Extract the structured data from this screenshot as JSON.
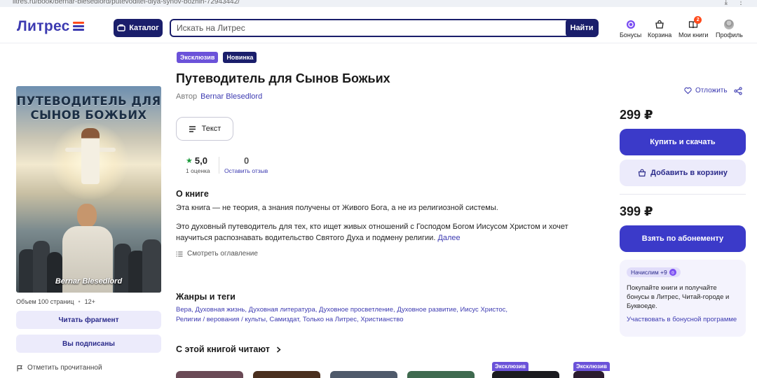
{
  "browser": {
    "url": "litres.ru/book/bernar-blesedlord/putevoditel-dlya-synov-bozhih-72943442/"
  },
  "header": {
    "logo": "Литрес",
    "catalog_label": "Каталог",
    "search_placeholder": "Искать на Литрес",
    "search_button": "Найти",
    "nav": [
      {
        "label": "Бонусы",
        "icon": "bonus-icon"
      },
      {
        "label": "Корзина",
        "icon": "cart-icon"
      },
      {
        "label": "Мои книги",
        "icon": "my-books-icon",
        "badge": "2"
      },
      {
        "label": "Профиль",
        "icon": "avatar"
      }
    ]
  },
  "book": {
    "badges": [
      "Эксклюзив",
      "Новинка"
    ],
    "title": "Путеводитель для Сынов Божьих",
    "author_prefix": "Автор",
    "author": "Bernar Blesedlord",
    "cover_title": "ПУТЕВОДИТЕЛЬ ДЛЯ СЫНОВ БОЖЬИХ",
    "cover_author": "Bernar Blesedlord",
    "pages": "Объем 100 страниц",
    "age": "12+",
    "format_label": "Текст",
    "rating_value": "5,0",
    "rating_count": "1 оценка",
    "reviews_count": "0",
    "reviews_link": "Оставить отзыв"
  },
  "left": {
    "read_fragment": "Читать фрагмент",
    "subscribed": "Вы подписаны",
    "mark_read": "Отметить прочитанной"
  },
  "about": {
    "heading": "О книге",
    "p1": "Эта книга — не теория, а знания получены от Живого Бога, а не из религиозной системы.",
    "p2": "Это духовный путеводитель для тех, кто ищет живых отношений с Господом Богом Иисусом Христом и хочет научиться распознавать водительство Святого Духа и подмену религии.",
    "more": "Далее",
    "toc": "Смотреть оглавление"
  },
  "genres": {
    "heading": "Жанры и теги",
    "items": [
      "Вера",
      "Духовная жизнь",
      "Духовная литература",
      "Духовное просветление",
      "Духовное развитие",
      "Иисус Христос",
      "Религии / верования / культы",
      "Самиздат",
      "Только на Литрес",
      "Христианство"
    ]
  },
  "recommend": {
    "heading": "С этой книгой читают",
    "thumb_tag": "Эксклюзив"
  },
  "purchase": {
    "wishlist": "Отложить",
    "price": "299 ₽",
    "buy": "Купить и скачать",
    "add_cart": "Добавить в корзину",
    "sub_price": "399 ₽",
    "subscribe": "Взять по абонементу",
    "bonus_pill": "Начислим +9",
    "bonus_text": "Покупайте книги и получайте бонусы в Литрес, Читай-городе и Буквоеде.",
    "bonus_link": "Участвовать в бонусной программе"
  },
  "colors": {
    "brand": "#3d3bb1",
    "primary_button": "#3b3ac9",
    "dark_navy": "#1a1e6b",
    "exclusive_tag": "#6b52d9",
    "rating_star": "#1b9a3a"
  }
}
